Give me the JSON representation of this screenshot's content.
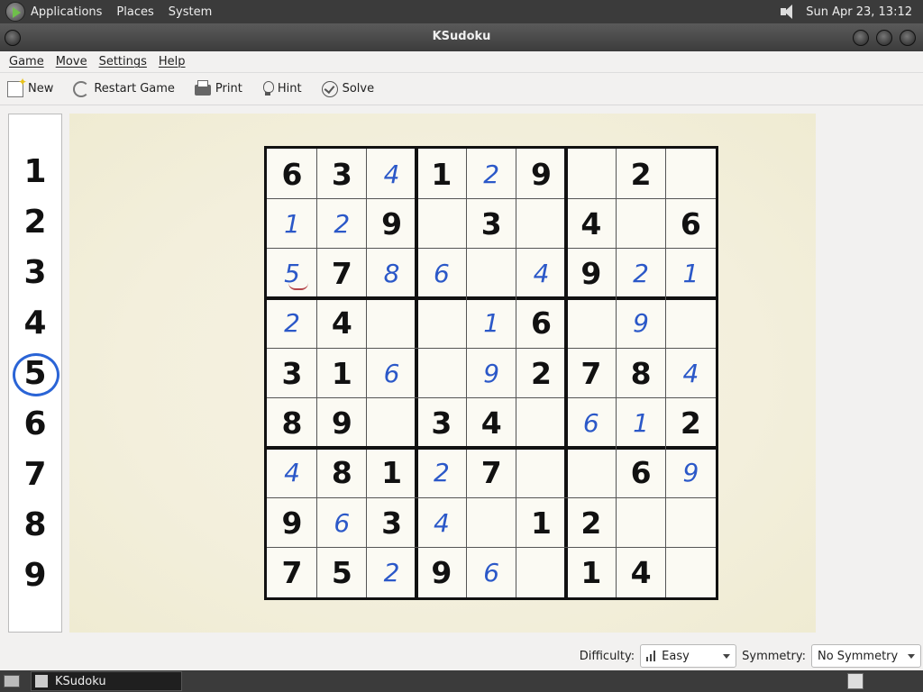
{
  "top_panel": {
    "menus": [
      "Applications",
      "Places",
      "System"
    ],
    "clock": "Sun Apr 23, 13:12"
  },
  "window": {
    "title": "KSudoku"
  },
  "menubar": {
    "items": [
      "Game",
      "Move",
      "Settings",
      "Help"
    ]
  },
  "toolbar": {
    "new": "New",
    "restart": "Restart Game",
    "print": "Print",
    "hint": "Hint",
    "solve": "Solve"
  },
  "number_panel": {
    "numbers": [
      "1",
      "2",
      "3",
      "4",
      "5",
      "6",
      "7",
      "8",
      "9"
    ],
    "selected": "5"
  },
  "board": {
    "rows": [
      [
        [
          "6",
          "g"
        ],
        [
          "3",
          "g"
        ],
        [
          "4",
          "u"
        ],
        [
          "1",
          "g"
        ],
        [
          "2",
          "u"
        ],
        [
          "9",
          "g"
        ],
        [
          "",
          ""
        ],
        [
          "2",
          "g"
        ],
        [
          "",
          ""
        ]
      ],
      [
        [
          "1",
          "u"
        ],
        [
          "2",
          "u"
        ],
        [
          "9",
          "g"
        ],
        [
          "",
          ""
        ],
        [
          "3",
          "g"
        ],
        [
          "",
          ""
        ],
        [
          "4",
          "g"
        ],
        [
          "",
          ""
        ],
        [
          "6",
          "g"
        ]
      ],
      [
        [
          "5",
          "u"
        ],
        [
          "7",
          "g"
        ],
        [
          "8",
          "u"
        ],
        [
          "6",
          "u"
        ],
        [
          "",
          ""
        ],
        [
          "4",
          "u"
        ],
        [
          "9",
          "g"
        ],
        [
          "2",
          "u"
        ],
        [
          "1",
          "u"
        ]
      ],
      [
        [
          "2",
          "u"
        ],
        [
          "4",
          "g"
        ],
        [
          "",
          ""
        ],
        [
          "",
          ""
        ],
        [
          "1",
          "u"
        ],
        [
          "6",
          "g"
        ],
        [
          "",
          ""
        ],
        [
          "9",
          "u"
        ],
        [
          "",
          ""
        ]
      ],
      [
        [
          "3",
          "g"
        ],
        [
          "1",
          "g"
        ],
        [
          "6",
          "u"
        ],
        [
          "",
          ""
        ],
        [
          "9",
          "u"
        ],
        [
          "2",
          "g"
        ],
        [
          "7",
          "g"
        ],
        [
          "8",
          "g"
        ],
        [
          "4",
          "u"
        ]
      ],
      [
        [
          "8",
          "g"
        ],
        [
          "9",
          "g"
        ],
        [
          "",
          ""
        ],
        [
          "3",
          "g"
        ],
        [
          "4",
          "g"
        ],
        [
          "",
          ""
        ],
        [
          "6",
          "u"
        ],
        [
          "1",
          "u"
        ],
        [
          "2",
          "g"
        ]
      ],
      [
        [
          "4",
          "u"
        ],
        [
          "8",
          "g"
        ],
        [
          "1",
          "g"
        ],
        [
          "2",
          "u"
        ],
        [
          "7",
          "g"
        ],
        [
          "",
          ""
        ],
        [
          "",
          ""
        ],
        [
          "6",
          "g"
        ],
        [
          "9",
          "u"
        ]
      ],
      [
        [
          "9",
          "g"
        ],
        [
          "6",
          "u"
        ],
        [
          "3",
          "g"
        ],
        [
          "4",
          "u"
        ],
        [
          "",
          ""
        ],
        [
          "1",
          "g"
        ],
        [
          "2",
          "g"
        ],
        [
          "",
          ""
        ],
        [
          "",
          ""
        ]
      ],
      [
        [
          "7",
          "g"
        ],
        [
          "5",
          "g"
        ],
        [
          "2",
          "u"
        ],
        [
          "9",
          "g"
        ],
        [
          "6",
          "u"
        ],
        [
          "",
          ""
        ],
        [
          "1",
          "g"
        ],
        [
          "4",
          "g"
        ],
        [
          "",
          ""
        ]
      ]
    ],
    "marked_cell": [
      2,
      0
    ],
    "colors": {
      "given": "#111111",
      "user": "#2b58c8",
      "mark": "#b4454a",
      "selection": "#2a64d6"
    }
  },
  "statusbar": {
    "difficulty_label": "Difficulty:",
    "difficulty_value": "Easy",
    "symmetry_label": "Symmetry:",
    "symmetry_value": "No Symmetry"
  },
  "taskbar": {
    "task_label": "KSudoku"
  }
}
